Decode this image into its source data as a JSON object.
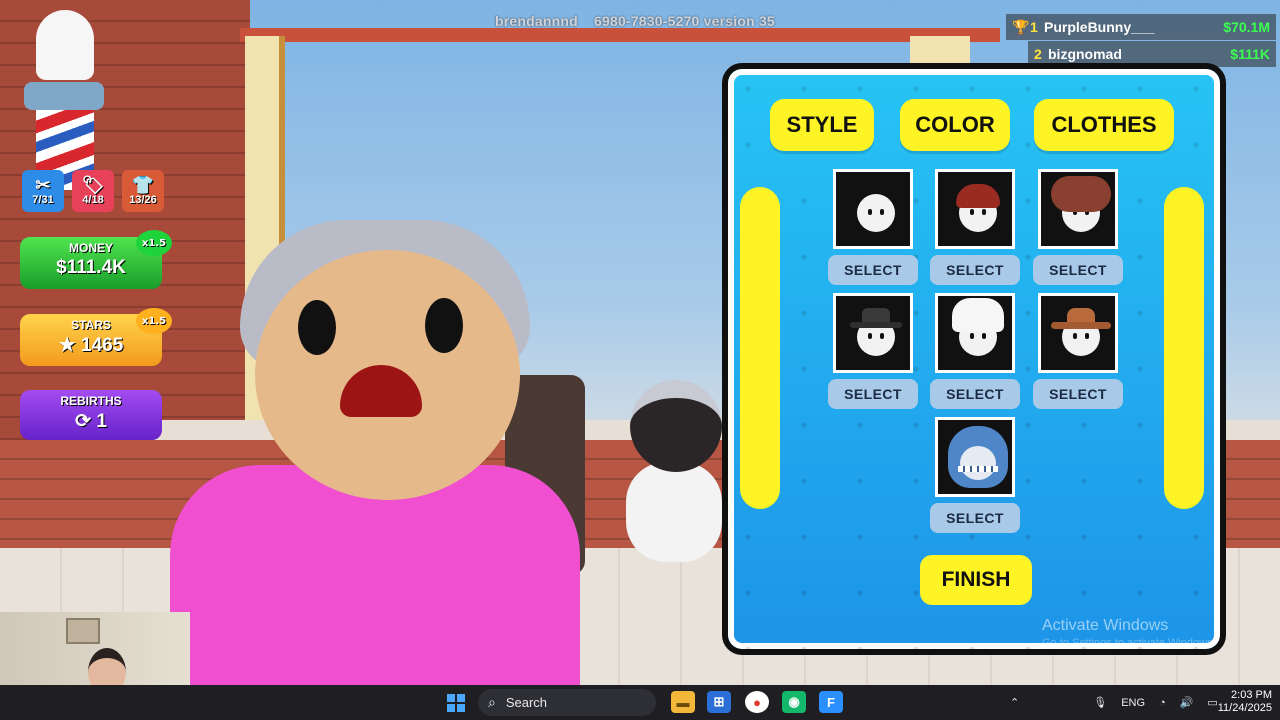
{
  "header": {
    "username": "brendannnd",
    "code": "6980-7830-5270 version 35"
  },
  "leaderboard": [
    {
      "rank": "1",
      "name": "PurpleBunny___",
      "value": "$70.1M"
    },
    {
      "rank": "2",
      "name": "bizgnomad",
      "value": "$111K"
    }
  ],
  "hud": {
    "counters": [
      {
        "icon": "scissors-icon",
        "value": "7/31"
      },
      {
        "icon": "tag-icon",
        "value": "4/18"
      },
      {
        "icon": "shirt-icon",
        "value": "13/26"
      }
    ],
    "money": {
      "label": "MONEY",
      "value": "$111.4K",
      "multiplier": "x1.5"
    },
    "stars": {
      "label": "STARS",
      "value": "★ 1465",
      "multiplier": "x1.5"
    },
    "rebirths": {
      "label": "REBIRTHS",
      "value": "1"
    }
  },
  "panel": {
    "tabs": [
      "STYLE",
      "COLOR",
      "CLOTHES"
    ],
    "items": [
      {
        "name": "plain",
        "select_label": "SELECT"
      },
      {
        "name": "red-hair",
        "select_label": "SELECT"
      },
      {
        "name": "curly-hair",
        "select_label": "SELECT"
      },
      {
        "name": "fedora-hat",
        "select_label": "SELECT"
      },
      {
        "name": "chef-hat",
        "select_label": "SELECT"
      },
      {
        "name": "cowboy-hat",
        "select_label": "SELECT"
      },
      {
        "name": "shark-hat",
        "select_label": "SELECT"
      }
    ],
    "finish_label": "FINISH"
  },
  "watermark": {
    "title": "Activate Windows",
    "subtitle": "Go to Settings to activate Windows."
  },
  "taskbar": {
    "search_placeholder": "Search",
    "language": "ENG",
    "time": "2:03 PM",
    "date": "11/24/2025"
  },
  "colors": {
    "panel_blue": "#1d94e8",
    "button_yellow": "#fdf325",
    "money_green": "#3bff4e"
  }
}
